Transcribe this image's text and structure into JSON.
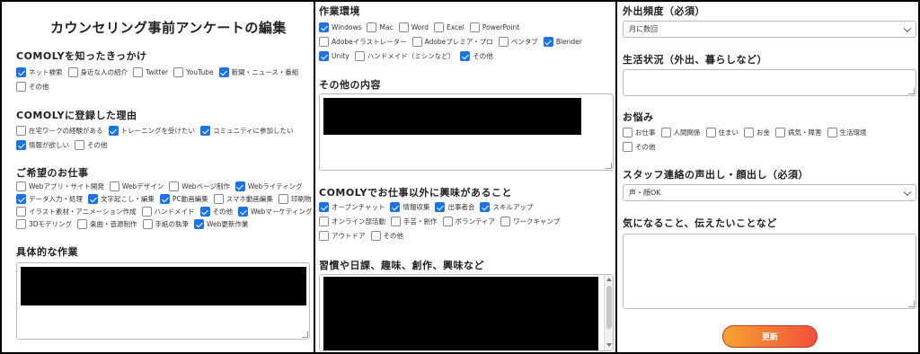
{
  "p1": {
    "title": "カウンセリング事前アンケートの編集",
    "q1": {
      "label": "COMOLYを知ったきっかけ",
      "rows": [
        [
          {
            "t": "ネット検索",
            "on": true
          },
          {
            "t": "身近な人の紹介",
            "on": false
          },
          {
            "t": "Twitter",
            "on": false
          },
          {
            "t": "YouTube",
            "on": false
          },
          {
            "t": "新聞・ニュース・番組",
            "on": true
          }
        ],
        [
          {
            "t": "その他",
            "on": false
          }
        ]
      ]
    },
    "q2": {
      "label": "COMOLYに登録した理由",
      "rows": [
        [
          {
            "t": "在宅ワークの経験がある",
            "on": false
          },
          {
            "t": "トレーニングを受けたい",
            "on": true
          },
          {
            "t": "コミュニティに参加したい",
            "on": true
          }
        ],
        [
          {
            "t": "情報が欲しい",
            "on": true
          },
          {
            "t": "その他",
            "on": false
          }
        ]
      ]
    },
    "q3": {
      "label": "ご希望のお仕事",
      "rows": [
        [
          {
            "t": "Webアプリ・サイト開発",
            "on": false
          },
          {
            "t": "Webデザイン",
            "on": false
          },
          {
            "t": "Webページ制作",
            "on": false
          },
          {
            "t": "Webライティング",
            "on": true
          }
        ],
        [
          {
            "t": "データ入力・処理",
            "on": true
          },
          {
            "t": "文字起こし・編集",
            "on": true
          },
          {
            "t": "PC動画編集",
            "on": true
          },
          {
            "t": "スマホ動画編集",
            "on": false
          },
          {
            "t": "印刷物デザイン",
            "on": false
          }
        ],
        [
          {
            "t": "イラスト素材・アニメーション作成",
            "on": false
          },
          {
            "t": "ハンドメイド",
            "on": false
          },
          {
            "t": "その他",
            "on": true
          },
          {
            "t": "Webマーケティング",
            "on": true
          }
        ],
        [
          {
            "t": "3Dモデリング",
            "on": false
          },
          {
            "t": "楽曲・音源制作",
            "on": false
          },
          {
            "t": "手紙の執筆",
            "on": false
          },
          {
            "t": "Web更新作業",
            "on": true
          }
        ]
      ]
    },
    "q4": {
      "label": "具体的な作業"
    }
  },
  "p2": {
    "q1": {
      "label": "作業環境",
      "rows": [
        [
          {
            "t": "Windows",
            "on": true
          },
          {
            "t": "Mac",
            "on": false
          },
          {
            "t": "Word",
            "on": false
          },
          {
            "t": "Excel",
            "on": false
          },
          {
            "t": "PowerPoint",
            "on": false
          }
        ],
        [
          {
            "t": "Adobeイラストレーター",
            "on": false
          },
          {
            "t": "Adobeプレミア・プロ",
            "on": false
          },
          {
            "t": "ペンタブ",
            "on": false
          },
          {
            "t": "Blender",
            "on": true
          }
        ],
        [
          {
            "t": "Unity",
            "on": true
          },
          {
            "t": "ハンドメイド（ミシンなど）",
            "on": false
          },
          {
            "t": "その他",
            "on": true
          }
        ]
      ]
    },
    "q2": {
      "label": "その他の内容"
    },
    "q3": {
      "label": "COMOLYでお仕事以外に興味があること",
      "rows": [
        [
          {
            "t": "オープンチャット",
            "on": true
          },
          {
            "t": "情報収集",
            "on": true
          },
          {
            "t": "出事者会",
            "on": true
          },
          {
            "t": "スキルアップ",
            "on": true
          }
        ],
        [
          {
            "t": "オンライン部活動",
            "on": false
          },
          {
            "t": "手芸・創作",
            "on": false
          },
          {
            "t": "ボランティア",
            "on": false
          },
          {
            "t": "ワークキャンプ",
            "on": false
          }
        ],
        [
          {
            "t": "アウトドア",
            "on": false
          },
          {
            "t": "その他",
            "on": false
          }
        ]
      ]
    },
    "q4": {
      "label": "習慣や日課、趣味、創作、興味など"
    }
  },
  "p3": {
    "q1": {
      "label": "外出頻度（必須）",
      "value": "月に数回"
    },
    "q2": {
      "label": "生活状況（外出、暮らしなど）"
    },
    "q3": {
      "label": "お悩み",
      "rows": [
        [
          {
            "t": "お仕事",
            "on": false
          },
          {
            "t": "人間関係",
            "on": false
          },
          {
            "t": "住まい",
            "on": false
          },
          {
            "t": "お金",
            "on": false
          },
          {
            "t": "病気・障害",
            "on": false
          },
          {
            "t": "生活環境",
            "on": false
          }
        ],
        [
          {
            "t": "その他",
            "on": false
          }
        ]
      ]
    },
    "q4": {
      "label": "スタッフ連絡の声出し・顔出し（必須）",
      "value": "声・顔OK"
    },
    "q5": {
      "label": "気になること、伝えたいことなど"
    },
    "submit": "更新"
  },
  "colors": {
    "check": "#1a73e8",
    "button_from": "#f7a230",
    "button_to": "#f2503b"
  }
}
